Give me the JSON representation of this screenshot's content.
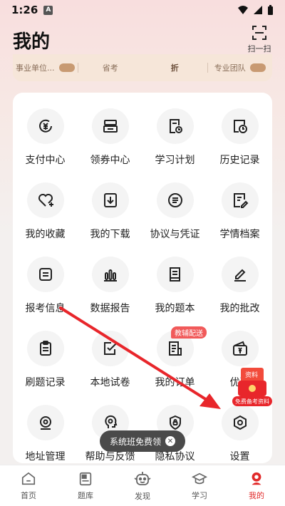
{
  "status_bar": {
    "time": "1:26",
    "notif_icon": "A"
  },
  "header": {
    "title": "我的",
    "scan_label": "扫一扫"
  },
  "promo_strip": {
    "items": [
      "事业单位...",
      "省考",
      "折",
      "专业团队"
    ]
  },
  "grid": [
    {
      "label": "支付中心",
      "icon": "payment-icon"
    },
    {
      "label": "领券中心",
      "icon": "coupon-icon"
    },
    {
      "label": "学习计划",
      "icon": "study-plan-icon"
    },
    {
      "label": "历史记录",
      "icon": "history-icon"
    },
    {
      "label": "我的收藏",
      "icon": "heart-icon"
    },
    {
      "label": "我的下载",
      "icon": "download-icon"
    },
    {
      "label": "协议与凭证",
      "icon": "agreement-icon"
    },
    {
      "label": "学情档案",
      "icon": "archive-icon"
    },
    {
      "label": "报考信息",
      "icon": "exam-info-icon"
    },
    {
      "label": "数据报告",
      "icon": "chart-icon"
    },
    {
      "label": "我的题本",
      "icon": "book-icon"
    },
    {
      "label": "我的批改",
      "icon": "pen-icon"
    },
    {
      "label": "刷题记录",
      "icon": "practice-record-icon"
    },
    {
      "label": "本地试卷",
      "icon": "local-paper-icon"
    },
    {
      "label": "我的订单",
      "icon": "order-icon",
      "badge": "教辅配送"
    },
    {
      "label": "优惠",
      "icon": "discount-icon"
    },
    {
      "label": "地址管理",
      "icon": "location-icon"
    },
    {
      "label": "帮助与反馈",
      "icon": "help-icon"
    },
    {
      "label": "隐私协议",
      "icon": "privacy-icon"
    },
    {
      "label": "设置",
      "icon": "settings-icon"
    }
  ],
  "float_promo": {
    "top": "资料",
    "label": "免费备考资料"
  },
  "toast": {
    "text": "系统班免费领"
  },
  "bottom_nav": [
    {
      "label": "首页",
      "icon": "home-icon"
    },
    {
      "label": "题库",
      "icon": "question-bank-icon"
    },
    {
      "label": "发现",
      "icon": "discover-icon"
    },
    {
      "label": "学习",
      "icon": "study-icon"
    },
    {
      "label": "我的",
      "icon": "profile-icon",
      "active": true
    }
  ],
  "colors": {
    "accent": "#e12a2a",
    "arrow": "#e8262b",
    "icon_stroke": "#222222"
  }
}
